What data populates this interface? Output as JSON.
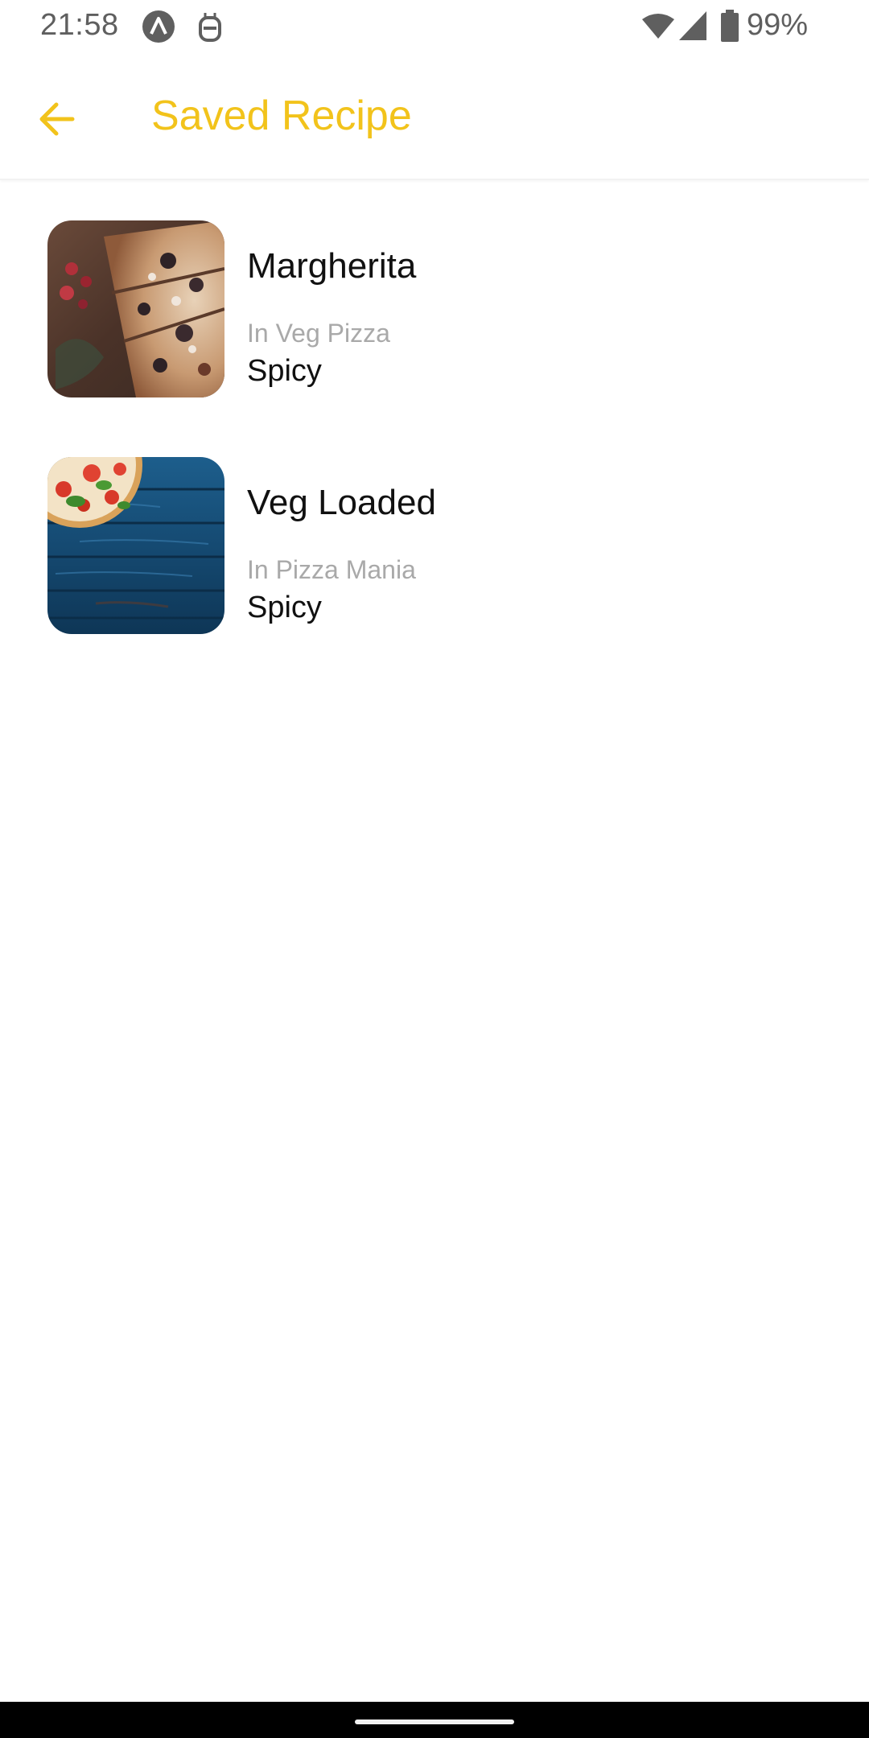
{
  "status_bar": {
    "time": "21:58",
    "battery": "99%",
    "icons": [
      "app-a-icon",
      "notification-icon",
      "wifi-icon",
      "cell-signal-icon",
      "battery-icon"
    ]
  },
  "app_bar": {
    "title": "Saved Recipe",
    "back_icon": "arrow-back-icon",
    "accent_color": "#F2C31B"
  },
  "recipes": [
    {
      "name": "Margherita",
      "category": "In Veg Pizza",
      "tag": "Spicy",
      "image": "pizza-slices-photo"
    },
    {
      "name": "Veg Loaded",
      "category": "In Pizza Mania",
      "tag": "Spicy",
      "image": "pizza-on-blue-wood-photo"
    }
  ]
}
